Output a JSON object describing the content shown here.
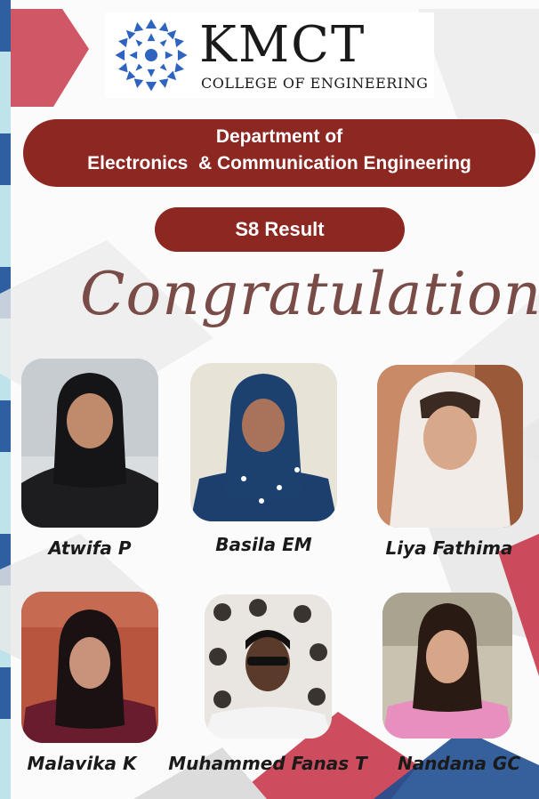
{
  "logo": {
    "title": "KMCT",
    "subtitle": "COLLEGE OF ENGINEERING"
  },
  "department": {
    "line1": "Department of",
    "line2": "Electronics  & Communication Engineering"
  },
  "result_label": "S8 Result",
  "greeting": "Congratulations",
  "students": [
    {
      "name": "Atwifa P"
    },
    {
      "name": "Basila EM"
    },
    {
      "name": "Liya Fathima"
    },
    {
      "name": "Malavika K"
    },
    {
      "name": "Muhammed Fanas T"
    },
    {
      "name": "Nandana GC"
    }
  ],
  "colors": {
    "banner": "#8d2722",
    "script_text": "#7a4c47",
    "logo_blue": "#2f63c0",
    "accent_pink": "#c8394b"
  }
}
